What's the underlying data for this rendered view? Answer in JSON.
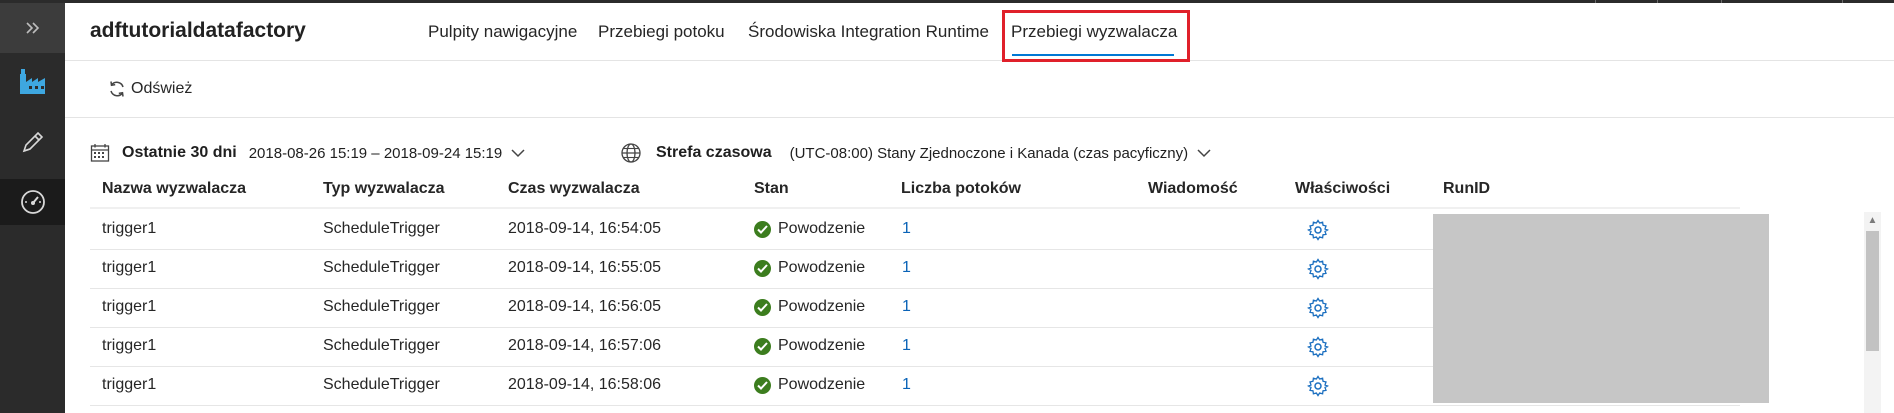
{
  "app": {
    "name": "adftutorialdatafactory"
  },
  "nav": {
    "tabs": [
      {
        "label": "Pulpity nawigacyjne"
      },
      {
        "label": "Przebiegi potoku"
      },
      {
        "label": "Środowiska Integration Runtime"
      },
      {
        "label": "Przebiegi wyzwalacza",
        "active": true
      }
    ]
  },
  "toolbar": {
    "refresh_label": "Odśwież"
  },
  "filters": {
    "range_label": "Ostatnie 30 dni",
    "range_value": "2018-08-26 15:19 – 2018-09-24 15:19",
    "timezone_label": "Strefa czasowa",
    "timezone_value": "(UTC-08:00) Stany Zjednoczone i Kanada (czas pacyficzny)"
  },
  "table": {
    "columns": [
      "Nazwa wyzwalacza",
      "Typ wyzwalacza",
      "Czas wyzwalacza",
      "Stan",
      "Liczba potoków",
      "Wiadomość",
      "Właściwości",
      "RunID"
    ],
    "rows": [
      {
        "name": "trigger1",
        "type": "ScheduleTrigger",
        "time": "2018-09-14, 16:54:05",
        "status": "Powodzenie",
        "pipelines": "1",
        "message": ""
      },
      {
        "name": "trigger1",
        "type": "ScheduleTrigger",
        "time": "2018-09-14, 16:55:05",
        "status": "Powodzenie",
        "pipelines": "1",
        "message": ""
      },
      {
        "name": "trigger1",
        "type": "ScheduleTrigger",
        "time": "2018-09-14, 16:56:05",
        "status": "Powodzenie",
        "pipelines": "1",
        "message": ""
      },
      {
        "name": "trigger1",
        "type": "ScheduleTrigger",
        "time": "2018-09-14, 16:57:06",
        "status": "Powodzenie",
        "pipelines": "1",
        "message": ""
      },
      {
        "name": "trigger1",
        "type": "ScheduleTrigger",
        "time": "2018-09-14, 16:58:06",
        "status": "Powodzenie",
        "pipelines": "1",
        "message": ""
      }
    ]
  },
  "colors": {
    "rail": "#2b2b2b",
    "accent": "#0078d4",
    "highlight": "#e0202a",
    "success": "#3c7d1e",
    "link": "#0a63b7"
  },
  "icons": {
    "rail": [
      "expand-chevrons-icon",
      "factory-icon",
      "pencil-icon",
      "monitor-gauge-icon"
    ],
    "toolbar": "refresh-icon",
    "filters": [
      "calendar-icon",
      "globe-icon",
      "chevron-down-icon"
    ],
    "row": [
      "success-check-icon",
      "gear-icon"
    ]
  }
}
